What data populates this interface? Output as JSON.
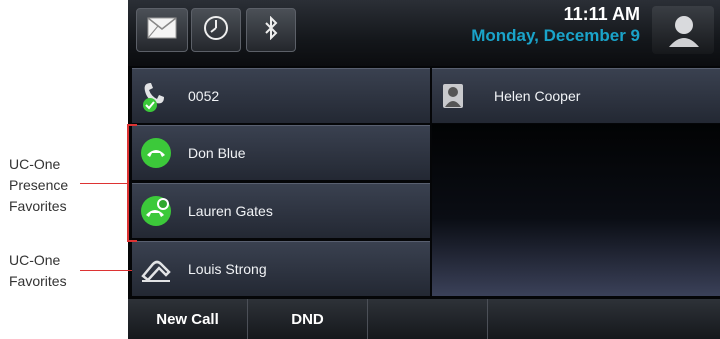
{
  "callouts": {
    "presence": [
      "UC-One",
      "Presence",
      "Favorites"
    ],
    "favorites": [
      "UC-One",
      "Favorites"
    ]
  },
  "topbar": {
    "icons": [
      "envelope-icon",
      "clock-icon",
      "bluetooth-icon"
    ],
    "time": "11:11 AM",
    "date": "Monday, December 9",
    "avatar_icon": "person-avatar-icon"
  },
  "lines": [
    {
      "label": "0052",
      "icon": "line-handset-icon"
    },
    {
      "label": "Don Blue",
      "icon": "presence-available-icon"
    },
    {
      "label": "Lauren Gates",
      "icon": "presence-busy-icon"
    },
    {
      "label": "Louis Strong",
      "icon": "favorite-handset-icon"
    }
  ],
  "contact": {
    "label": "Helen Cooper",
    "icon": "contact-person-icon"
  },
  "softkeys": [
    "New Call",
    "DND"
  ],
  "colors": {
    "accent_date": "#1aa3c9",
    "callout_line": "#dd3333",
    "presence_green": "#3cc93a"
  }
}
